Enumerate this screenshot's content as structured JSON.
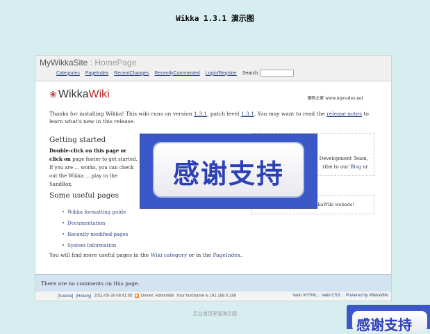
{
  "title": "Wikka 1.3.1 演示图",
  "header": {
    "site_name": "MyWikkaSite",
    "separator": " : ",
    "page_name": "HomePage",
    "menu": [
      "Categories",
      "PageIndex",
      "RecentChanges",
      "RecentlyCommented",
      "Login/Register"
    ],
    "search_label": "Search:",
    "search_value": ""
  },
  "content": {
    "logo_wikka": "Wikka",
    "logo_wiki": "Wiki",
    "tagline": "源码之家 www.mycodes.net",
    "intro_1": "Thanks for installing Wikka! This wiki runs on version ",
    "intro_version": "1.3.1",
    "intro_2": ", patch level ",
    "intro_patch": "1,3,1",
    "intro_3": ". You may want to read the ",
    "intro_release": "release notes",
    "intro_4": " to learn what's new in this release.",
    "getting_started_heading": "Getting started",
    "gs_bold": "Double-click on this page or click on",
    "gs_text": " page footer to get started. If you are ... works, you can check out the Wikka ... play in the SandBox.",
    "right_box_line1": "h Development Team,",
    "right_box_line2a": "ribe to our ",
    "right_box_blog": "Blog",
    "right_box_line2b": " or",
    "forget_text": "Don't forget to visit the WikkaWiki website!",
    "useful_pages_heading": "Some useful pages",
    "useful_pages": [
      "Wikka formatting guide",
      "Documentation",
      "Recently modified pages",
      "System Information"
    ],
    "more_1": "You will find more useful pages in the ",
    "more_link1": "Wiki category",
    "more_2": " or in the ",
    "more_link2": "PageIndex",
    "more_3": "."
  },
  "comments": {
    "text": "There are no comments on this page."
  },
  "footer": {
    "source": "[Source]",
    "history": "[History]",
    "timestamp": "2011-05-28 08:41:55",
    "owner": "Owner: Admin888",
    "hostname": "Your hostname is 192.168.0.188",
    "right": "Valid XHTML :: Valid CSS: :: Powered by WikkaWiki"
  },
  "overlay": {
    "text": "感谢支持"
  },
  "caption": "后台首页界面演示图",
  "corner_badge": "感谢支持"
}
